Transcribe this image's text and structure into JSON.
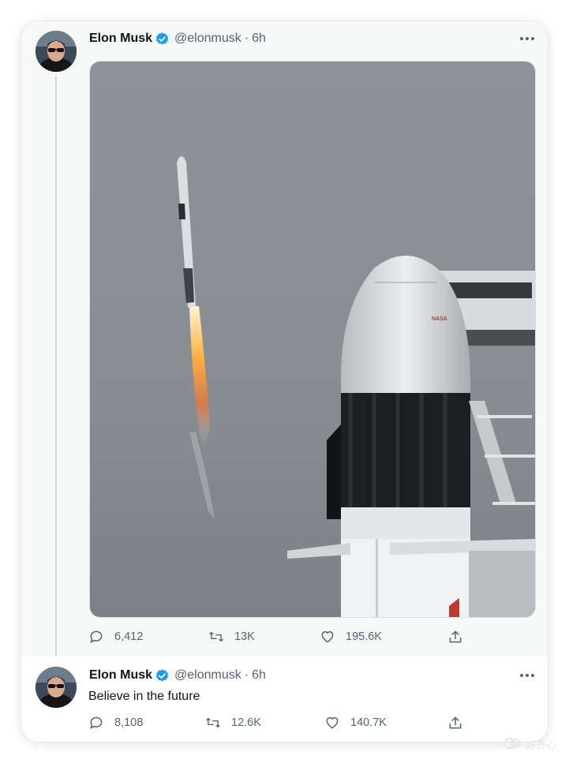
{
  "tweets": [
    {
      "author": {
        "name": "Elon Musk",
        "handle": "@elonmusk",
        "time": "6h"
      },
      "media": {
        "description_icon": "rocket-launch-photo",
        "capsule_logo": "NASA"
      },
      "stats": {
        "replies": "6,412",
        "retweets": "13K",
        "likes": "195.6K"
      }
    },
    {
      "author": {
        "name": "Elon Musk",
        "handle": "@elonmusk",
        "time": "6h"
      },
      "text": "Believe in the future",
      "stats": {
        "replies": "8,108",
        "retweets": "12.6K",
        "likes": "140.7K"
      }
    }
  ],
  "colors": {
    "text": "#0f1419",
    "secondary": "#536471",
    "verified": "#1d9bf0",
    "sky": "#8f969b"
  },
  "watermark": {
    "text": "好奇心"
  }
}
